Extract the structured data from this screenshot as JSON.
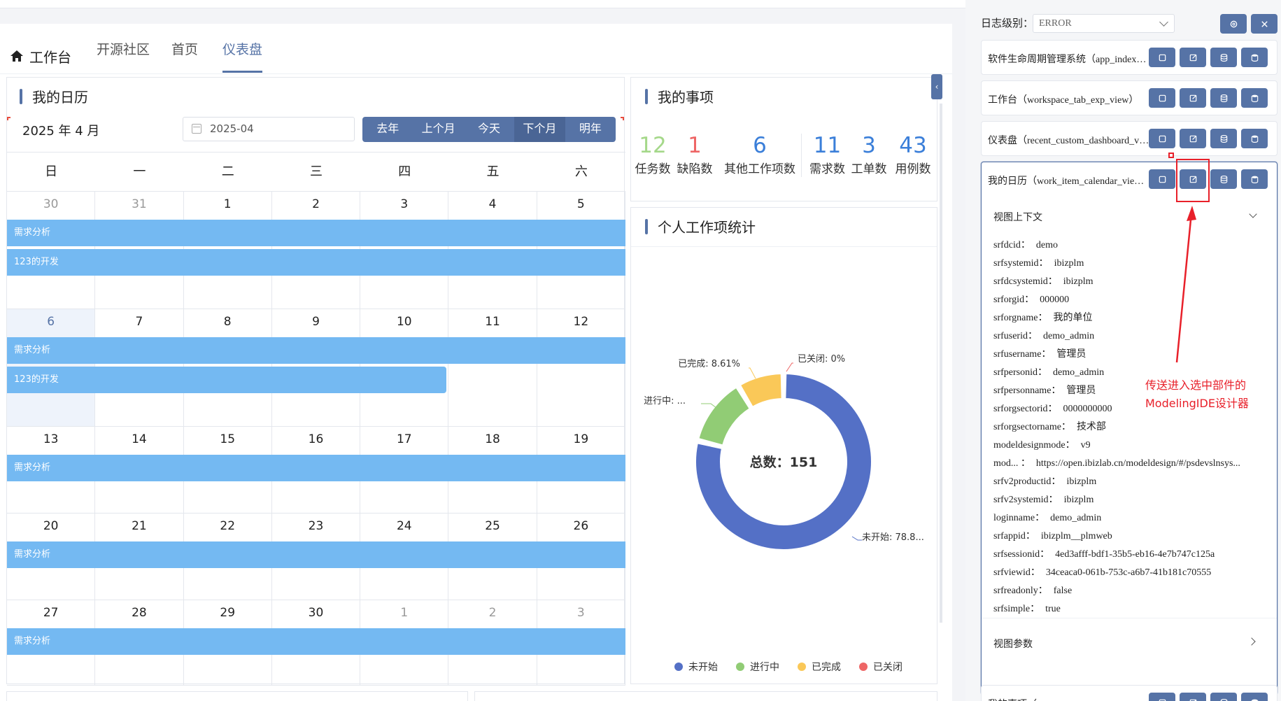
{
  "nav": {
    "tabs": [
      {
        "label": "工作台"
      },
      {
        "label": "开源社区"
      },
      {
        "label": "首页"
      },
      {
        "label": "仪表盘"
      }
    ]
  },
  "calendar": {
    "title": "我的日历",
    "month_label": "2025 年 4 月",
    "date_value": "2025-04",
    "nav_buttons": [
      "去年",
      "上个月",
      "今天",
      "下个月",
      "明年"
    ],
    "weekdays": [
      "日",
      "一",
      "二",
      "三",
      "四",
      "五",
      "六"
    ],
    "weeks": [
      [
        "30",
        "31",
        "1",
        "2",
        "3",
        "4",
        "5"
      ],
      [
        "6",
        "7",
        "8",
        "9",
        "10",
        "11",
        "12"
      ],
      [
        "13",
        "14",
        "15",
        "16",
        "17",
        "18",
        "19"
      ],
      [
        "20",
        "21",
        "22",
        "23",
        "24",
        "25",
        "26"
      ],
      [
        "27",
        "28",
        "29",
        "30",
        "1",
        "2",
        "3"
      ]
    ],
    "events": {
      "analysis": "需求分析",
      "dev": "123的开发"
    }
  },
  "my_items": {
    "title": "我的事项",
    "stats": [
      {
        "value": "12",
        "label": "任务数",
        "color": "#a5d88a"
      },
      {
        "value": "1",
        "label": "缺陷数",
        "color": "#ee6666"
      },
      {
        "value": "6",
        "label": "其他工作项数",
        "color": "#3b7fd9"
      },
      {
        "value": "11",
        "label": "需求数",
        "color": "#3b7fd9"
      },
      {
        "value": "3",
        "label": "工单数",
        "color": "#3b7fd9"
      },
      {
        "value": "43",
        "label": "用例数",
        "color": "#3b7fd9"
      }
    ]
  },
  "personal_stats": {
    "title": "个人工作项统计",
    "total_label": "总数：151",
    "chart_data": {
      "type": "pie",
      "title": "",
      "total": 151,
      "slices": [
        {
          "name": "未开始",
          "percent": 78.8,
          "label": "未开始: 78.8...",
          "color": "#5470c6"
        },
        {
          "name": "进行中",
          "percent": 12.59,
          "label": "进行中: ...",
          "color": "#91cc75"
        },
        {
          "name": "已完成",
          "percent": 8.61,
          "label": "已完成: 8.61%",
          "color": "#fac858"
        },
        {
          "name": "已关闭",
          "percent": 0,
          "label": "已关闭: 0%",
          "color": "#ee6666"
        }
      ],
      "legend": [
        "未开始",
        "进行中",
        "已完成",
        "已关闭"
      ],
      "legend_position": "bottom"
    }
  },
  "panel": {
    "log_level_label": "日志级别：",
    "log_level_value": "ERROR",
    "rows": [
      {
        "title": "软件生命周期管理系统（app_index_v..."
      },
      {
        "title": "工作台（workspace_tab_exp_view）"
      },
      {
        "title": "仪表盘（recent_custom_dashboard_vie..."
      },
      {
        "title": "我的日历（work_item_calendar_view）"
      },
      {
        "title": "我的事项（recent_recent_summary_vi..."
      }
    ],
    "context_header": "视图上下文",
    "params_header": "视图参数",
    "context": [
      {
        "k": "srfdcid：",
        "v": "demo"
      },
      {
        "k": "srfsystemid：",
        "v": "ibizplm"
      },
      {
        "k": "srfdcsystemid：",
        "v": "ibizplm"
      },
      {
        "k": "srforgid：",
        "v": "000000"
      },
      {
        "k": "srforgname：",
        "v": "我的单位"
      },
      {
        "k": "srfuserid：",
        "v": "demo_admin"
      },
      {
        "k": "srfusername：",
        "v": "管理员"
      },
      {
        "k": "srfpersonid：",
        "v": "demo_admin"
      },
      {
        "k": "srfpersonname：",
        "v": "管理员"
      },
      {
        "k": "srforgsectorid：",
        "v": "0000000000"
      },
      {
        "k": "srforgsectorname：",
        "v": "技术部"
      },
      {
        "k": "modeldesignmode：",
        "v": "v9"
      },
      {
        "k": "mod... ：",
        "v": "https://open.ibizlab.cn/modeldesign/#/psdevslnsys..."
      },
      {
        "k": "srfv2productid：",
        "v": "ibizplm"
      },
      {
        "k": "srfv2systemid：",
        "v": "ibizplm"
      },
      {
        "k": "loginname：",
        "v": "demo_admin"
      },
      {
        "k": "srfappid：",
        "v": "ibizplm__plmweb"
      },
      {
        "k": "srfsessionid：",
        "v": "4ed3afff-bdf1-35b5-eb16-4e7b747c125a"
      },
      {
        "k": "srfviewid：",
        "v": "34ceaca0-061b-753c-a6b7-41b181c70555"
      },
      {
        "k": "srfreadonly：",
        "v": "false"
      },
      {
        "k": "srfsimple：",
        "v": "true"
      }
    ]
  },
  "annotation": {
    "line1": "传送进入选中部件的",
    "line2": "ModelingIDE设计器"
  }
}
